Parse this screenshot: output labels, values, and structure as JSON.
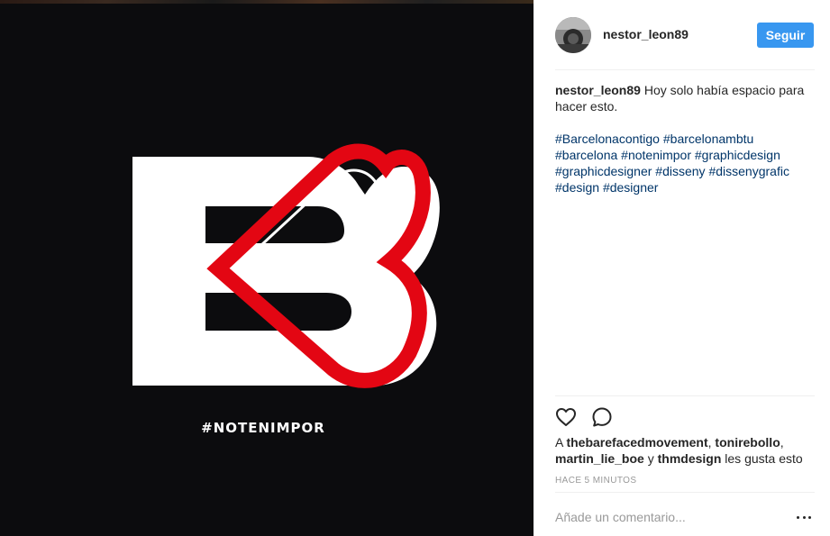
{
  "media": {
    "overlay_text": "#NOTENIMPOR",
    "colors": {
      "background": "#0c0c0e",
      "logo_white": "#ffffff",
      "logo_red": "#e30613"
    }
  },
  "header": {
    "username": "nestor_leon89",
    "follow_label": "Seguir",
    "accent_color": "#3897f0"
  },
  "caption": {
    "author": "nestor_leon89",
    "text": "Hoy solo había espacio para hacer esto.",
    "hashtags": [
      "#Barcelonacontigo",
      "#barcelonambtu",
      "#barcelona",
      "#notenimpor",
      "#graphicdesign",
      "#graphicdesigner",
      "#disseny",
      "#dissenygrafic",
      "#design",
      "#designer"
    ]
  },
  "actions": {
    "like_icon": "heart-outline-icon",
    "comment_icon": "speech-bubble-icon"
  },
  "likes": {
    "prefix": "A",
    "users": [
      "thebarefacedmovement",
      "tonirebollo",
      "martin_lie_boe",
      "thmdesign"
    ],
    "sep1": ",",
    "sep2": ",",
    "conjunction": "y",
    "suffix": "les gusta esto"
  },
  "timestamp": "HACE 5 MINUTOS",
  "comment_box": {
    "placeholder": "Añade un comentario...",
    "more_icon": "ellipsis-icon"
  }
}
